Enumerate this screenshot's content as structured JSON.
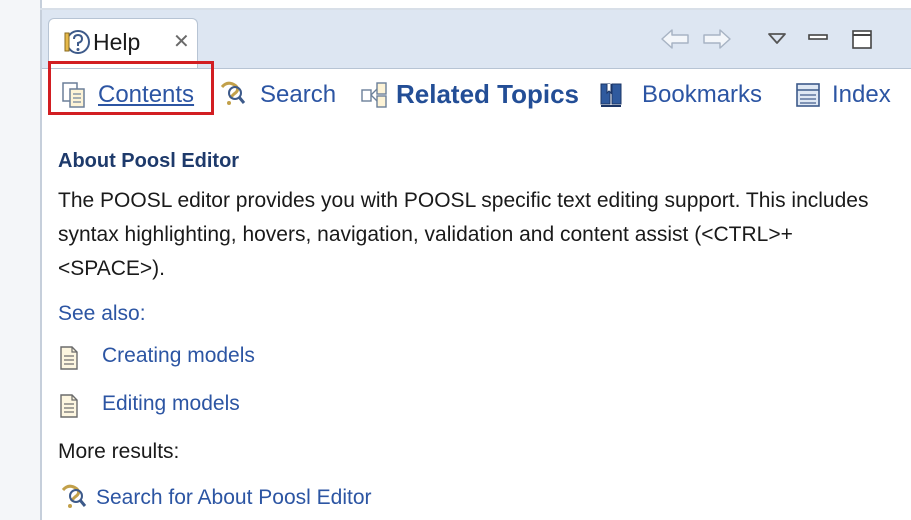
{
  "tab": {
    "title": "Help",
    "close_symbol": "✕"
  },
  "toolbar": {
    "contents": "Contents",
    "search": "Search",
    "related_topics": "Related Topics",
    "bookmarks": "Bookmarks",
    "index": "Index"
  },
  "content": {
    "title": "About Poosl Editor",
    "description": "The POOSL editor provides you with POOSL specific text editing support. This includes syntax highlighting, hovers, navigation, validation and content assist (<CTRL>+<SPACE>).",
    "see_also_label": "See also:",
    "links": [
      "Creating models",
      "Editing models"
    ],
    "more_results_label": "More results:",
    "search_result": "Search for About Poosl Editor"
  },
  "colors": {
    "link": "#2c55a3",
    "highlight_box": "#d21e22",
    "tab_bar": "#dde6f2"
  }
}
